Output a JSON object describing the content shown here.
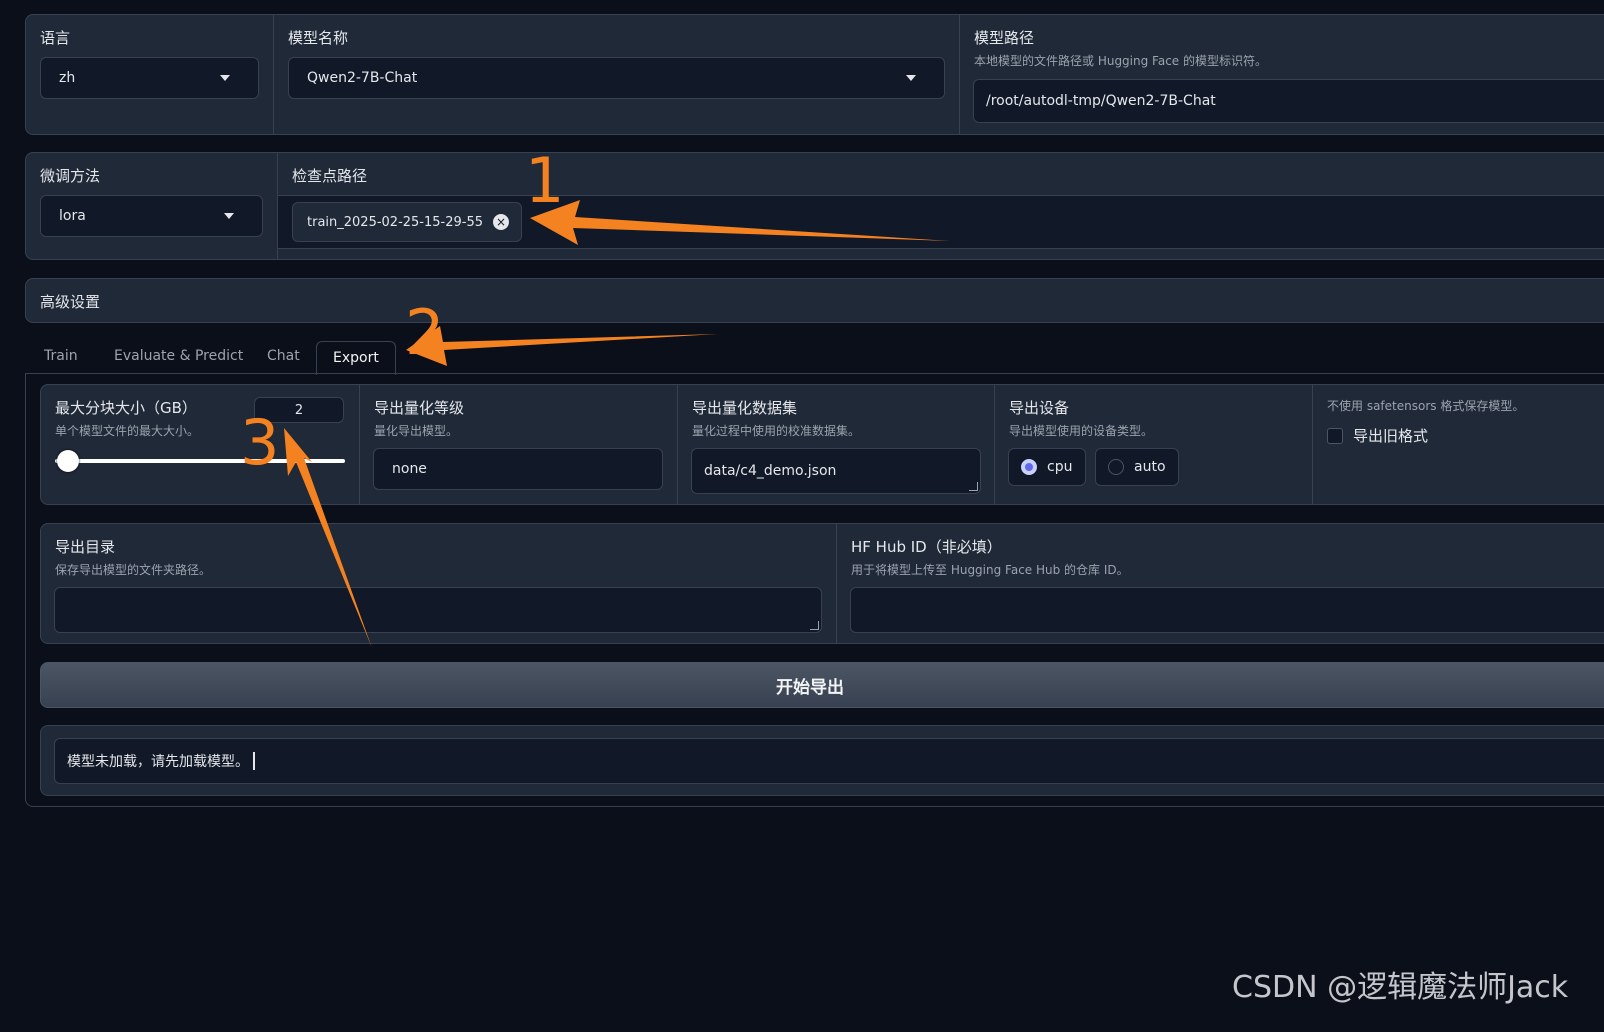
{
  "row1": {
    "language": {
      "label": "语言",
      "value": "zh"
    },
    "model_name": {
      "label": "模型名称",
      "value": "Qwen2-7B-Chat"
    },
    "model_path": {
      "label": "模型路径",
      "info": "本地模型的文件路径或 Hugging Face 的模型标识符。",
      "value": "/root/autodl-tmp/Qwen2-7B-Chat"
    }
  },
  "row2": {
    "finetune": {
      "label": "微调方法",
      "value": "lora"
    },
    "checkpoint": {
      "label": "检查点路径",
      "chip": "train_2025-02-25-15-29-55",
      "chip_close": "×"
    }
  },
  "advanced": {
    "label": "高级设置"
  },
  "tabs": [
    {
      "label": "Train"
    },
    {
      "label": "Evaluate & Predict"
    },
    {
      "label": "Chat"
    },
    {
      "label": "Export",
      "active": true
    }
  ],
  "export": {
    "shard_size": {
      "label": "最大分块大小（GB）",
      "info": "单个模型文件的最大大小。",
      "value": "2"
    },
    "quant_bit": {
      "label": "导出量化等级",
      "info": "量化导出模型。",
      "value": "none"
    },
    "quant_dataset": {
      "label": "导出量化数据集",
      "info": "量化过程中使用的校准数据集。",
      "value": "data/c4_demo.json"
    },
    "device": {
      "label": "导出设备",
      "info": "导出模型使用的设备类型。",
      "options": [
        "cpu",
        "auto"
      ],
      "selected": "cpu"
    },
    "legacy": {
      "info": "不使用 safetensors 格式保存模型。",
      "label": "导出旧格式",
      "checked": false
    },
    "export_dir": {
      "label": "导出目录",
      "info": "保存导出模型的文件夹路径。",
      "value": ""
    },
    "hub_id": {
      "label": "HF Hub ID（非必填）",
      "info": "用于将模型上传至 Hugging Face Hub 的仓库 ID。",
      "value": ""
    },
    "start_button": "开始导出",
    "output": "模型未加载，请先加载模型。"
  },
  "annotations": [
    "1",
    "2",
    "3"
  ],
  "watermark": "CSDN @逻辑魔法师Jack",
  "colors": {
    "accent": "#f58220",
    "radio_selected": "#6366f1",
    "background": "#0b0f19",
    "panel": "#1f2937"
  }
}
